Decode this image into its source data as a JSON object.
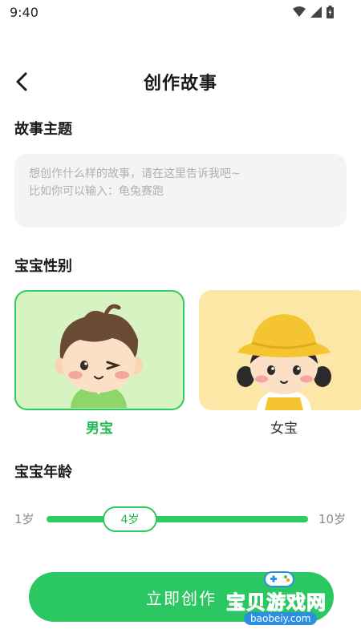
{
  "status": {
    "time": "9:40"
  },
  "header": {
    "title": "创作故事"
  },
  "topic": {
    "label": "故事主题",
    "placeholder_line1": "想创作什么样的故事，请在这里告诉我吧~",
    "placeholder_line2": "比如你可以输入：龟兔赛跑"
  },
  "gender": {
    "label": "宝宝性别",
    "options": [
      {
        "label": "男宝",
        "selected": true
      },
      {
        "label": "女宝",
        "selected": false
      }
    ]
  },
  "age": {
    "label": "宝宝年龄",
    "min_label": "1岁",
    "max_label": "10岁",
    "value_label": "4岁",
    "value": 4,
    "min": 1,
    "max": 10
  },
  "actions": {
    "create_label": "立即创作"
  },
  "watermark": {
    "text": "宝贝游戏网",
    "url": "baobeiy.com"
  },
  "colors": {
    "accent": "#2bc763",
    "boy_card": "#d8f3c2",
    "girl_card": "#fde7a6"
  }
}
